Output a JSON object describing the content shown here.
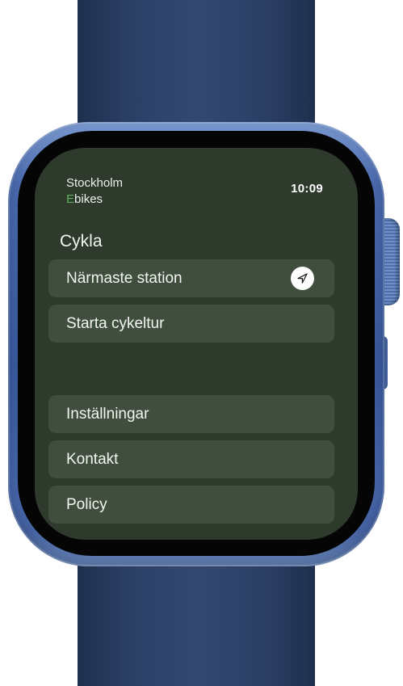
{
  "brand": {
    "line1": "Stockholm",
    "line2_accent": "E",
    "line2_rest": "bikes"
  },
  "status": {
    "time": "10:09"
  },
  "section": {
    "title": "Cykla"
  },
  "menu": {
    "primary": [
      {
        "label": "Närmaste station",
        "icon": "location-arrow-icon"
      },
      {
        "label": "Starta cykeltur"
      }
    ],
    "secondary": [
      {
        "label": "Inställningar"
      },
      {
        "label": "Kontakt"
      },
      {
        "label": "Policy"
      }
    ]
  },
  "colors": {
    "screen_background": "#2d3a2c",
    "menu_item_background": "#3f4e3d",
    "brand_accent": "#5fae5a",
    "case": "#3b5ba1",
    "band": "#2d4168"
  }
}
